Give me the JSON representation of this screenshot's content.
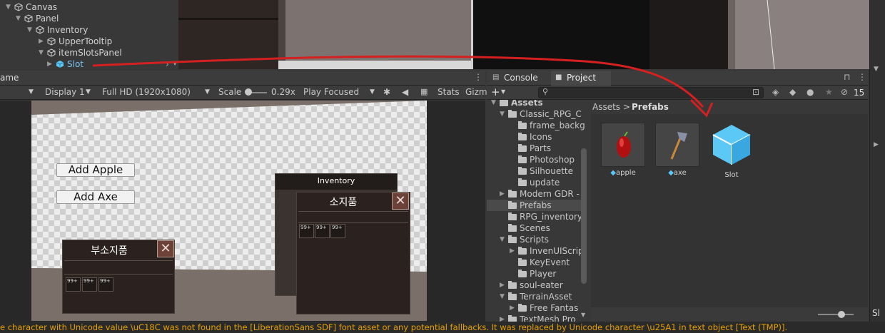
{
  "hierarchy": {
    "items": [
      {
        "label": "Canvas"
      },
      {
        "label": "Panel"
      },
      {
        "label": "Inventory"
      },
      {
        "label": "UpperTooltip"
      },
      {
        "label": "itemSlotsPanel"
      },
      {
        "label": "Slot"
      }
    ]
  },
  "game": {
    "tab_label": "ame",
    "display": "Display 1",
    "resolution": "Full HD (1920x1080)",
    "scale_label": "Scale",
    "scale_value": "0.29x",
    "play_mode": "Play Focused",
    "stats": "Stats",
    "gizmos": "Gizm",
    "add_apple": "Add Apple",
    "add_axe": "Add Axe",
    "sub_inventory_title": "부소지품",
    "inventory_header": "Inventory",
    "inventory_title": "소지품",
    "slot_count": "99+",
    "close_glyph": "✕"
  },
  "project": {
    "tab_console": "Console",
    "tab_project": "Project",
    "hidden_count": "15",
    "breadcrumb_root": "Assets",
    "breadcrumb_sep": ">",
    "breadcrumb_current": "Prefabs",
    "tree": [
      {
        "label": "Assets"
      },
      {
        "label": "Classic_RPG_C"
      },
      {
        "label": "frame_backg"
      },
      {
        "label": "Icons"
      },
      {
        "label": "Parts"
      },
      {
        "label": "Photoshop"
      },
      {
        "label": "Silhouette"
      },
      {
        "label": "update"
      },
      {
        "label": "Modern GDR -"
      },
      {
        "label": "Prefabs"
      },
      {
        "label": "RPG_inventory"
      },
      {
        "label": "Scenes"
      },
      {
        "label": "Scripts"
      },
      {
        "label": "InvenUIScrip"
      },
      {
        "label": "KeyEvent"
      },
      {
        "label": "Player"
      },
      {
        "label": "soul-eater"
      },
      {
        "label": "TerrainAsset"
      },
      {
        "label": "Free Fantas"
      },
      {
        "label": "TextMesh Pro"
      }
    ],
    "assets": [
      {
        "label": "apple"
      },
      {
        "label": "axe"
      },
      {
        "label": "Slot"
      }
    ]
  },
  "right_panel_label": "Sl",
  "status_message": "e character with Unicode value \\uC18C was not found in the [LiberationSans SDF] font asset or any potential fallbacks. It was replaced by Unicode character \\u25A1 in text object [Text (TMP)].",
  "colors": {
    "annotation_arrow": "#d42020",
    "prefab_cube": "#5bc8f5",
    "warning_text": "#e6a000",
    "selected_row": "#4a4a4a"
  }
}
